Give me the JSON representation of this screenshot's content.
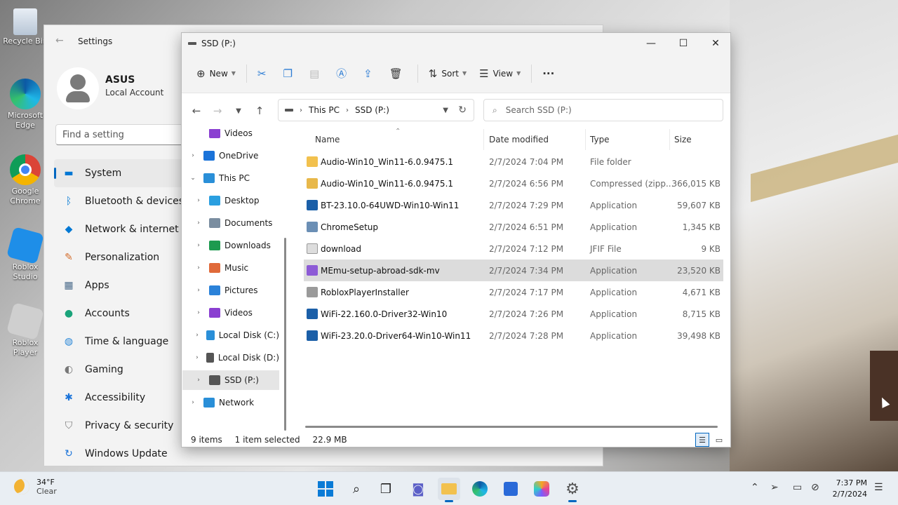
{
  "desktop": {
    "icons": [
      {
        "label": "Recycle Bin",
        "icon": "recycle-bin-icon"
      },
      {
        "label": "Microsoft Edge",
        "icon": "edge-icon"
      },
      {
        "label": "Google Chrome",
        "icon": "chrome-icon"
      },
      {
        "label": "Roblox Studio",
        "icon": "roblox-studio-icon"
      },
      {
        "label": "Roblox Player",
        "icon": "roblox-player-icon"
      }
    ]
  },
  "settings": {
    "title": "Settings",
    "account_name": "ASUS",
    "account_type": "Local Account",
    "search_placeholder": "Find a setting",
    "nav": [
      {
        "label": "System",
        "icon": "monitor-icon"
      },
      {
        "label": "Bluetooth & devices",
        "icon": "bluetooth-icon"
      },
      {
        "label": "Network & internet",
        "icon": "wifi-icon"
      },
      {
        "label": "Personalization",
        "icon": "brush-icon"
      },
      {
        "label": "Apps",
        "icon": "apps-icon"
      },
      {
        "label": "Accounts",
        "icon": "person-icon"
      },
      {
        "label": "Time & language",
        "icon": "globe-clock-icon"
      },
      {
        "label": "Gaming",
        "icon": "gamepad-icon"
      },
      {
        "label": "Accessibility",
        "icon": "accessibility-icon"
      },
      {
        "label": "Privacy & security",
        "icon": "shield-icon"
      },
      {
        "label": "Windows Update",
        "icon": "update-icon"
      }
    ]
  },
  "explorer": {
    "title": "SSD (P:)",
    "toolbar": {
      "new_label": "New",
      "sort_label": "Sort",
      "view_label": "View"
    },
    "breadcrumb": [
      "This PC",
      "SSD (P:)"
    ],
    "search_placeholder": "Search SSD (P:)",
    "tree": [
      {
        "label": "Videos",
        "indent": 1,
        "expander": false,
        "color": "#8a3fd1"
      },
      {
        "label": "OneDrive",
        "indent": 0,
        "expander": true,
        "color": "#1a73d9"
      },
      {
        "label": "This PC",
        "indent": 0,
        "expander": true,
        "expanded": true,
        "color": "#2a8fd8"
      },
      {
        "label": "Desktop",
        "indent": 1,
        "expander": true,
        "color": "#2a9fe0"
      },
      {
        "label": "Documents",
        "indent": 1,
        "expander": true,
        "color": "#7a8da0"
      },
      {
        "label": "Downloads",
        "indent": 1,
        "expander": true,
        "color": "#1d9a4f"
      },
      {
        "label": "Music",
        "indent": 1,
        "expander": true,
        "color": "#e06a3a"
      },
      {
        "label": "Pictures",
        "indent": 1,
        "expander": true,
        "color": "#2b82d9"
      },
      {
        "label": "Videos",
        "indent": 1,
        "expander": true,
        "color": "#8a3fd1"
      },
      {
        "label": "Local Disk (C:)",
        "indent": 1,
        "expander": true,
        "color": "#2a8fd8"
      },
      {
        "label": "Local Disk (D:)",
        "indent": 1,
        "expander": true,
        "color": "#555555"
      },
      {
        "label": "SSD (P:)",
        "indent": 1,
        "expander": true,
        "color": "#555555",
        "selected": true
      },
      {
        "label": "Network",
        "indent": 0,
        "expander": true,
        "color": "#2a8fd8"
      }
    ],
    "columns": {
      "name": "Name",
      "date": "Date modified",
      "type": "Type",
      "size": "Size"
    },
    "files": [
      {
        "name": "Audio-Win10_Win11-6.0.9475.1",
        "date": "2/7/2024 7:04 PM",
        "type": "File folder",
        "size": "",
        "icon": "folder-icon",
        "color": "#f2c14e"
      },
      {
        "name": "Audio-Win10_Win11-6.0.9475.1",
        "date": "2/7/2024 6:56 PM",
        "type": "Compressed (zipp...",
        "size": "366,015 KB",
        "icon": "zip-folder-icon",
        "color": "#e8b84a"
      },
      {
        "name": "BT-23.10.0-64UWD-Win10-Win11",
        "date": "2/7/2024 7:29 PM",
        "type": "Application",
        "size": "59,607 KB",
        "icon": "intel-app-icon",
        "color": "#1b5fa8"
      },
      {
        "name": "ChromeSetup",
        "date": "2/7/2024 6:51 PM",
        "type": "Application",
        "size": "1,345 KB",
        "icon": "installer-icon",
        "color": "#6b8fb5"
      },
      {
        "name": "download",
        "date": "2/7/2024 7:12 PM",
        "type": "JFIF File",
        "size": "9 KB",
        "icon": "file-icon",
        "color": "#dddddd"
      },
      {
        "name": "MEmu-setup-abroad-sdk-mv",
        "date": "2/7/2024 7:34 PM",
        "type": "Application",
        "size": "23,520 KB",
        "icon": "memu-icon",
        "color": "#8d5bd6",
        "selected": true
      },
      {
        "name": "RobloxPlayerInstaller",
        "date": "2/7/2024 7:17 PM",
        "type": "Application",
        "size": "4,671 KB",
        "icon": "roblox-icon",
        "color": "#9a9a9a"
      },
      {
        "name": "WiFi-22.160.0-Driver32-Win10",
        "date": "2/7/2024 7:26 PM",
        "type": "Application",
        "size": "8,715 KB",
        "icon": "intel-app-icon",
        "color": "#1b5fa8"
      },
      {
        "name": "WiFi-23.20.0-Driver64-Win10-Win11",
        "date": "2/7/2024 7:28 PM",
        "type": "Application",
        "size": "39,498 KB",
        "icon": "intel-app-icon",
        "color": "#1b5fa8"
      }
    ],
    "status": {
      "count": "9 items",
      "selected": "1 item selected",
      "size": "22.9 MB"
    }
  },
  "taskbar": {
    "weather_temp": "34°F",
    "weather_desc": "Clear",
    "time": "7:37 PM",
    "date": "2/7/2024",
    "apps": [
      "start-icon",
      "search-icon",
      "task-view-icon",
      "chat-icon",
      "file-explorer-icon",
      "edge-icon",
      "store-icon",
      "memu-icon",
      "settings-icon"
    ]
  },
  "colors": {
    "accent": "#0067c0",
    "selection": "#dcdcdc"
  }
}
